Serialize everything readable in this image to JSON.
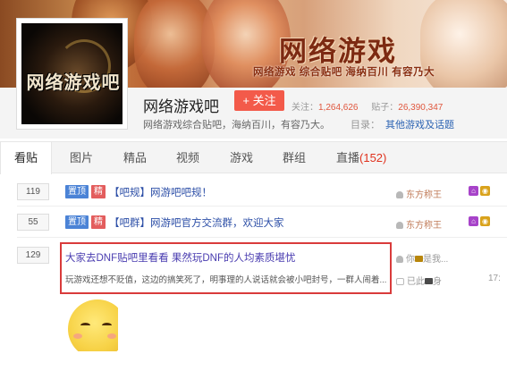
{
  "banner": {
    "title": "网络游戏",
    "slogan": "网络游戏 综合贴吧  海纳百川 有容乃大"
  },
  "forum": {
    "avatar_text": "网络游戏吧",
    "name": "网络游戏吧",
    "follow_label": "+ 关注",
    "followers_label": "关注：",
    "followers": "1,264,626",
    "posts_label": "贴子：",
    "posts": "26,390,347",
    "description": "网络游戏综合贴吧，海纳百川，有容乃大。",
    "catalog_label": "目录：",
    "catalog_link": "其他游戏及话题"
  },
  "tabs": [
    {
      "label": "看贴"
    },
    {
      "label": "图片"
    },
    {
      "label": "精品"
    },
    {
      "label": "视频"
    },
    {
      "label": "游戏"
    },
    {
      "label": "群组"
    },
    {
      "label": "直播",
      "count": "(152)"
    }
  ],
  "threads": [
    {
      "replies": "119",
      "tag_top": "置顶",
      "tag_good": "精",
      "title": "【吧规】网游吧吧规！",
      "author": "东方称王"
    },
    {
      "replies": "55",
      "tag_top": "置顶",
      "tag_good": "精",
      "title": "【吧群】网游吧官方交流群，欢迎大家",
      "author": "东方称王"
    },
    {
      "replies": "129",
      "title": "大家去DNF贴吧里看看 果然玩DNF的人均素质堪忧",
      "abstract": "玩游戏还想不贬值，这边的搞笑死了，明事理的人说话就会被小吧封号，一群人闹着...",
      "author_prefix": "你",
      "author_suffix": "是我...",
      "last_reply_prefix": "已此",
      "last_reply_suffix": "身",
      "time": "17:"
    }
  ],
  "colors": {
    "accent_red": "#f35a4a",
    "link_blue": "#2d64b3",
    "highlight_border": "#d93b3b",
    "count_red": "#e0321e"
  }
}
